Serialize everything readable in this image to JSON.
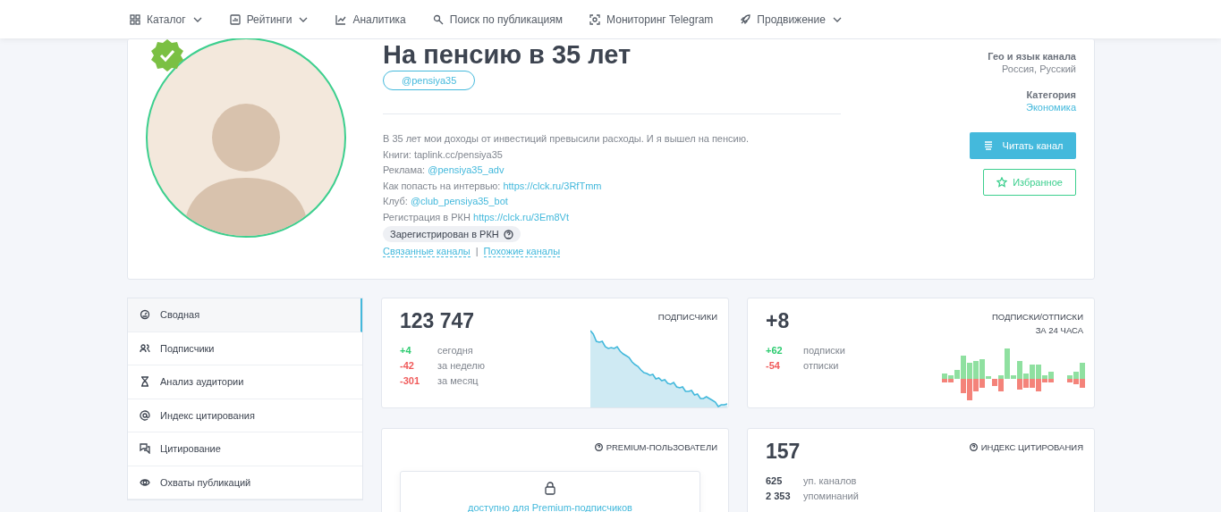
{
  "nav": [
    {
      "label": "Каталог",
      "dropdown": true
    },
    {
      "label": "Рейтинги",
      "dropdown": true
    },
    {
      "label": "Аналитика",
      "dropdown": false
    },
    {
      "label": "Поиск по публикациям",
      "dropdown": false
    },
    {
      "label": "Мониторинг Telegram",
      "dropdown": false
    },
    {
      "label": "Продвижение",
      "dropdown": true
    }
  ],
  "channel": {
    "title": "На пенсию в 35 лет",
    "handle": "@pensiya35",
    "verified": true,
    "description": [
      {
        "text": "В 35 лет мои доходы от инвестиций превысили расходы. И я вышел на пенсию."
      },
      {
        "text": "Книги: taplink.cc/pensiya35"
      },
      {
        "text": "Реклама: ",
        "link": "@pensiya35_adv"
      },
      {
        "text": "Как попасть на интервью: ",
        "link": "https://clck.ru/3RfTmm"
      },
      {
        "text": "Клуб: ",
        "link": "@club_pensiya35_bot"
      },
      {
        "text": "Регистрация в РКН ",
        "link": "https://clck.ru/3Em8Vt"
      }
    ],
    "badge": "Зарегистрирован в РКН",
    "links": [
      "Связанные каналы",
      "Похожие каналы"
    ],
    "separator": "|",
    "geo_label": "Гео и язык канала",
    "geo_value": "Россия, Русский",
    "category_label": "Категория",
    "category_value": "Экономика",
    "read_button": "Читать канал",
    "favorite_button": "Избранное"
  },
  "sidebar": {
    "items": [
      {
        "label": "Сводная",
        "selected": true
      },
      {
        "label": "Подписчики",
        "selected": false
      },
      {
        "label": "Анализ аудитории",
        "selected": false
      },
      {
        "label": "Индекс цитирования",
        "selected": false
      },
      {
        "label": "Цитирование",
        "selected": false
      },
      {
        "label": "Охваты публикаций",
        "selected": false
      }
    ]
  },
  "cards": [
    {
      "kind": "subscribers",
      "value": "123 747",
      "title": "ПОДПИСЧИКИ",
      "stats": [
        {
          "value": "+4",
          "label": "сегодня",
          "color": "#2ecc71"
        },
        {
          "value": "-42",
          "label": "за неделю",
          "color": "#f05b5b"
        },
        {
          "value": "-301",
          "label": "за месяц",
          "color": "#f05b5b"
        }
      ]
    },
    {
      "kind": "flow",
      "value": "+8",
      "title": "ПОДПИСКИ/ОТПИСКИ",
      "subtitle": "ЗА 24 ЧАСА",
      "stats": [
        {
          "value": "+62",
          "label": "подписки",
          "color": "#2ecc71"
        },
        {
          "value": "-54",
          "label": "отписки",
          "color": "#f05b5b"
        }
      ]
    },
    {
      "kind": "premium",
      "title": "PREMIUM-ПОЛЬЗОВАТЕЛИ",
      "locked_text": "доступно для Premium-подписчиков"
    },
    {
      "kind": "citation",
      "value": "157",
      "title": "ИНДЕКС ЦИТИРОВАНИЯ",
      "stats": [
        {
          "value": "625",
          "label": "уп. каналов",
          "color": "#3d4450"
        },
        {
          "value": "2 353",
          "label": "упоминаний",
          "color": "#3d4450"
        }
      ]
    }
  ]
}
